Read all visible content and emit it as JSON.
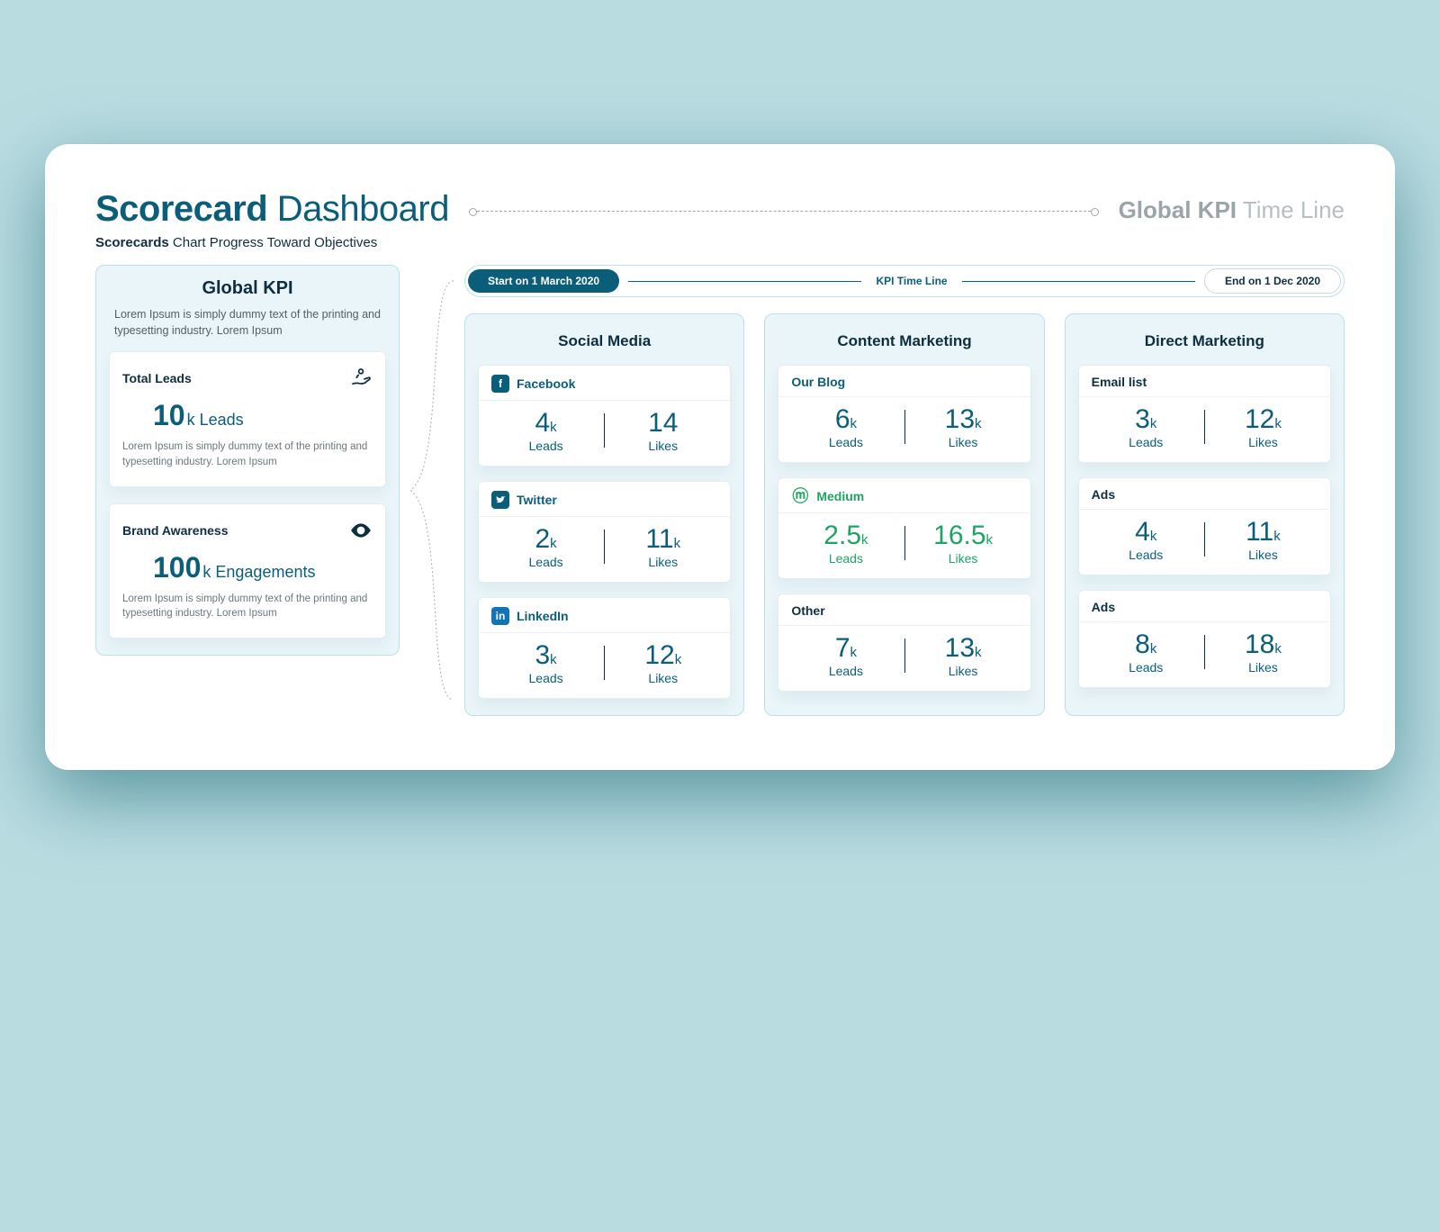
{
  "header": {
    "title_bold": "Scorecard",
    "title_rest": "Dashboard",
    "subtitle_bold": "Scorecards",
    "subtitle_rest": "Chart Progress Toward Objectives",
    "timeline_bold": "Global KPI",
    "timeline_rest": "Time Line"
  },
  "timeline": {
    "start_label": "Start on 1 March 2020",
    "mid_label": "KPI Time Line",
    "end_label": "End on 1 Dec 2020"
  },
  "left": {
    "heading": "Global KPI",
    "desc": "Lorem Ipsum is simply dummy text of the printing and typesetting industry. Lorem Ipsum",
    "cards": [
      {
        "label": "Total Leads",
        "icon": "hand-icon",
        "value": "10",
        "unit": "k Leads",
        "note": "Lorem Ipsum is simply dummy text of the printing and typesetting industry. Lorem Ipsum"
      },
      {
        "label": "Brand Awareness",
        "icon": "eye-icon",
        "value": "100",
        "unit": "k Engagements",
        "note": "Lorem Ipsum is simply dummy text of the printing and typesetting industry. Lorem Ipsum"
      }
    ]
  },
  "columns": [
    {
      "title": "Social Media",
      "cards": [
        {
          "name": "Facebook",
          "icon": "facebook-icon",
          "style": "brand",
          "leads": "4",
          "leads_k": "k",
          "likes": "14",
          "likes_k": "",
          "leads_label": "Leads",
          "likes_label": "Likes"
        },
        {
          "name": "Twitter",
          "icon": "twitter-icon",
          "style": "brand",
          "leads": "2",
          "leads_k": "k",
          "likes": "11",
          "likes_k": "k",
          "leads_label": "Leads",
          "likes_label": "Likes"
        },
        {
          "name": "LinkedIn",
          "icon": "linkedin-icon",
          "style": "brand",
          "leads": "3",
          "leads_k": "k",
          "likes": "12",
          "likes_k": "k",
          "leads_label": "Leads",
          "likes_label": "Likes"
        }
      ]
    },
    {
      "title": "Content Marketing",
      "cards": [
        {
          "name": "Our Blog",
          "icon": "",
          "style": "brand",
          "leads": "6",
          "leads_k": "k",
          "likes": "13",
          "likes_k": "k",
          "leads_label": "Leads",
          "likes_label": "Likes"
        },
        {
          "name": "Medium",
          "icon": "medium-icon",
          "style": "green",
          "leads": "2.5",
          "leads_k": "k",
          "likes": "16.5",
          "likes_k": "k",
          "leads_label": "Leads",
          "likes_label": "Likes"
        },
        {
          "name": "Other",
          "icon": "",
          "style": "plain",
          "leads": "7",
          "leads_k": "k",
          "likes": "13",
          "likes_k": "k",
          "leads_label": "Leads",
          "likes_label": "Likes"
        }
      ]
    },
    {
      "title": "Direct Marketing",
      "cards": [
        {
          "name": "Email list",
          "icon": "",
          "style": "plain",
          "leads": "3",
          "leads_k": "k",
          "likes": "12",
          "likes_k": "k",
          "leads_label": "Leads",
          "likes_label": "Likes"
        },
        {
          "name": "Ads",
          "icon": "",
          "style": "plain",
          "leads": "4",
          "leads_k": "k",
          "likes": "11",
          "likes_k": "k",
          "leads_label": "Leads",
          "likes_label": "Likes"
        },
        {
          "name": "Ads",
          "icon": "",
          "style": "plain",
          "leads": "8",
          "leads_k": "k",
          "likes": "18",
          "likes_k": "k",
          "leads_label": "Leads",
          "likes_label": "Likes"
        }
      ]
    }
  ]
}
